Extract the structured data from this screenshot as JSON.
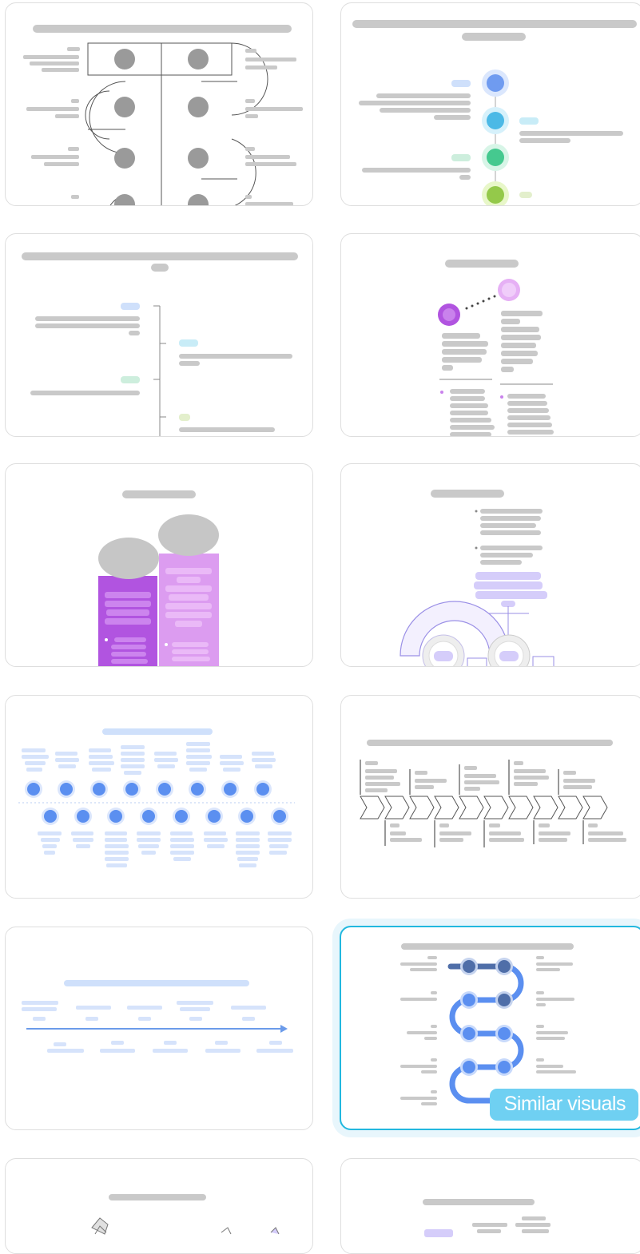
{
  "gallery": {
    "cards": [
      {
        "name": "card-serpentine-grey"
      },
      {
        "name": "card-vertical-dot-timeline"
      },
      {
        "name": "card-vertical-line-timeline"
      },
      {
        "name": "card-two-circle-comparison"
      },
      {
        "name": "card-purple-pillars"
      },
      {
        "name": "card-semicircle-diagram"
      },
      {
        "name": "card-blue-dot-rows"
      },
      {
        "name": "card-chevron-process"
      },
      {
        "name": "card-arrow-timeline"
      },
      {
        "name": "card-blue-serpentine",
        "selected": true,
        "badge": "Similar visuals"
      },
      {
        "name": "card-illustration-partial"
      },
      {
        "name": "card-text-partial"
      }
    ]
  },
  "colors": {
    "placeholder_grey": "#c9c9c9",
    "selected_border": "#22b8df",
    "badge_bg": "#6fd0f2",
    "purple_dark": "#b154e0",
    "purple_light": "#dc9cf0",
    "blue_dot": "#5b8ff0",
    "navy_dot": "#4f6ea8"
  }
}
